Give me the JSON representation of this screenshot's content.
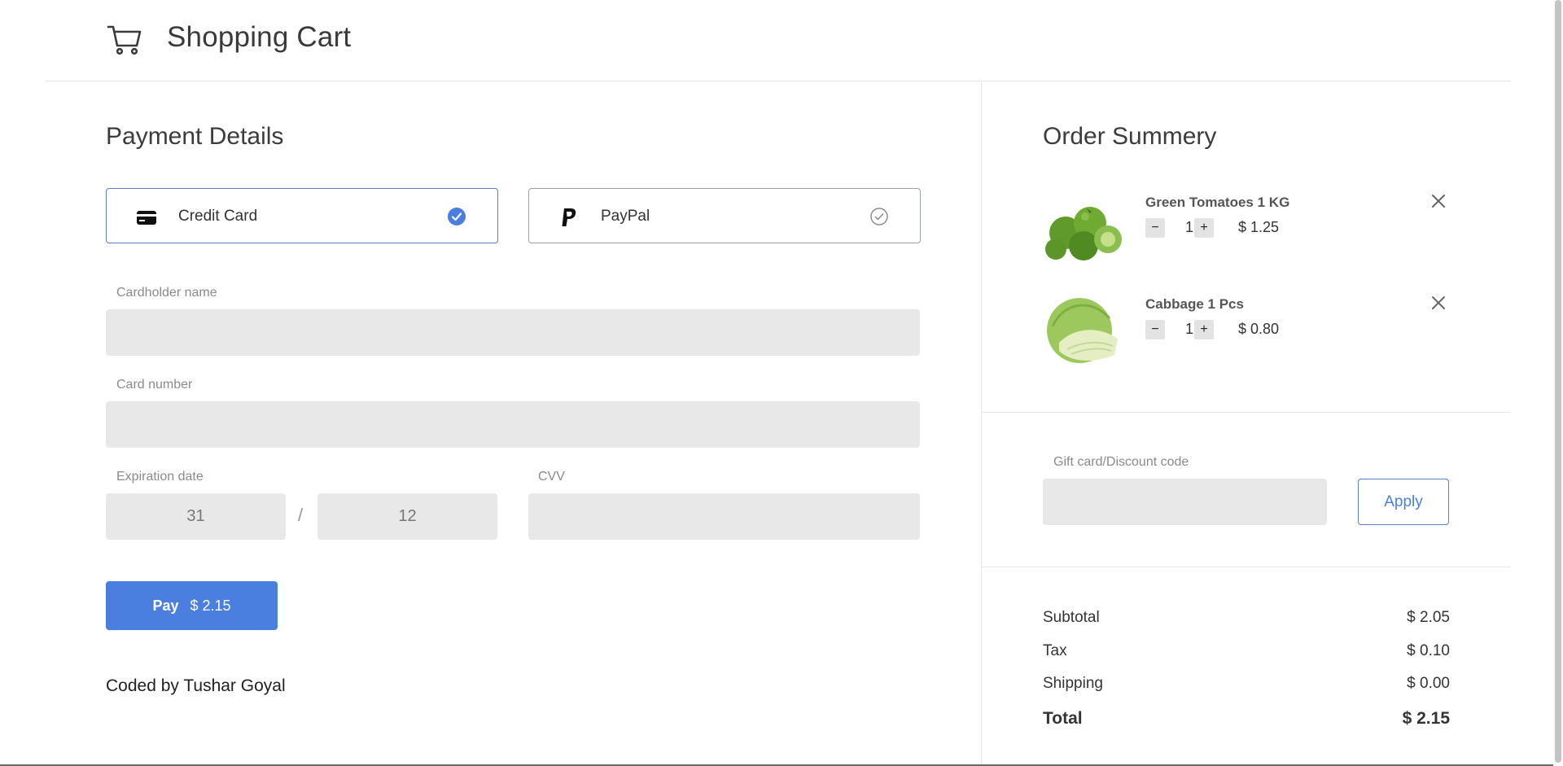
{
  "header": {
    "title": "Shopping Cart",
    "icon": "cart-icon"
  },
  "payment": {
    "title": "Payment Details",
    "methods": [
      {
        "label": "Credit Card",
        "icon": "credit-card-icon",
        "selected": true
      },
      {
        "label": "PayPal",
        "icon": "paypal-icon",
        "selected": false
      }
    ],
    "fields": {
      "cardholder_label": "Cardholder name",
      "cardholder_value": "",
      "card_number_label": "Card number",
      "card_number_value": "",
      "expiration_label": "Expiration date",
      "exp_day_value": "31",
      "exp_separator": "/",
      "exp_month_value": "12",
      "cvv_label": "CVV",
      "cvv_value": ""
    },
    "pay_button": {
      "label": "Pay",
      "amount": "$ 2.15"
    },
    "credit": "Coded by Tushar Goyal"
  },
  "summary": {
    "title": "Order Summery",
    "items": [
      {
        "name": "Green Tomatoes 1 KG",
        "qty": "1",
        "price": "$ 1.25",
        "minus": "−",
        "plus": "+"
      },
      {
        "name": "Cabbage 1 Pcs",
        "qty": "1",
        "price": "$ 0.80",
        "minus": "−",
        "plus": "+"
      }
    ],
    "discount": {
      "label": "Gift card/Discount code",
      "value": "",
      "apply_label": "Apply"
    },
    "totals": {
      "subtotal_label": "Subtotal",
      "subtotal": "$ 2.05",
      "tax_label": "Tax",
      "tax": "$ 0.10",
      "shipping_label": "Shipping",
      "shipping": "$ 0.00",
      "total_label": "Total",
      "total": "$ 2.15"
    }
  },
  "colors": {
    "accent": "#4a7fe0",
    "input_bg": "#e8e8e8",
    "border": "#e6e6e6"
  }
}
